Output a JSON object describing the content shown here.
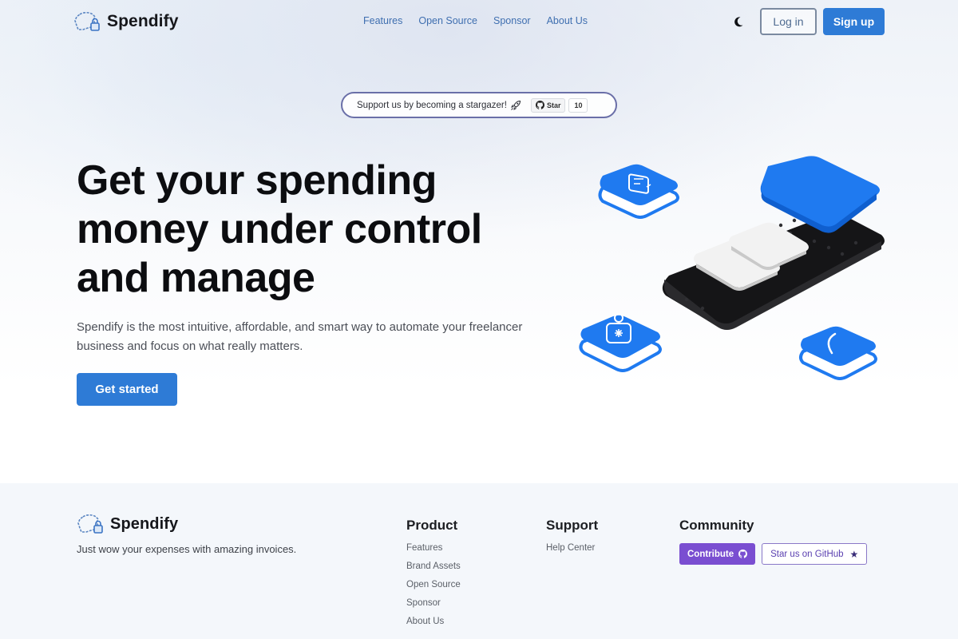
{
  "header": {
    "brand": "Spendify",
    "nav": [
      "Features",
      "Open Source",
      "Sponsor",
      "About Us"
    ],
    "theme_toggle_icon": "moon-icon",
    "login_label": "Log in",
    "signup_label": "Sign up"
  },
  "stargazer": {
    "text": "Support us by becoming a stargazer!",
    "icon": "rocket-icon",
    "star_button_label": "Star",
    "star_count": "10"
  },
  "hero": {
    "title_lines": [
      "Get your spending",
      "money under control",
      "and manage"
    ],
    "description": "Spendify is the most intuitive, affordable, and smart way to automate your freelancer business and focus on what really matters.",
    "cta_label": "Get started"
  },
  "colors": {
    "primary": "#2e7bd6",
    "illustration_blue": "#1f7af0",
    "phone_dark": "#1c1c1e",
    "contribute_purple": "#7a4ed1"
  },
  "footer": {
    "brand": "Spendify",
    "tagline": "Just wow your expenses with amazing invoices.",
    "product": {
      "heading": "Product",
      "links": [
        "Features",
        "Brand Assets",
        "Open Source",
        "Sponsor",
        "About Us"
      ]
    },
    "support": {
      "heading": "Support",
      "links": [
        "Help Center"
      ]
    },
    "community": {
      "heading": "Community",
      "contribute_label": "Contribute",
      "star_github_label": "Star us on GitHub"
    }
  }
}
